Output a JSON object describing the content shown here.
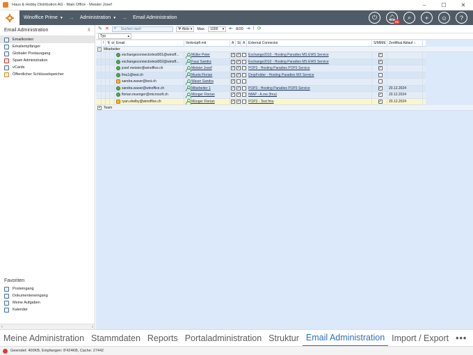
{
  "window": {
    "title": "Haus & Hobby Distribution AG - Main Office - Meister Josef"
  },
  "header": {
    "app_label": "Winoffice Prime",
    "section_label": "Administration",
    "page_label": "Email Administration",
    "notification_count": "65",
    "icons": [
      "power-icon",
      "bell-icon",
      "search-icon",
      "plus-icon",
      "user-icon",
      "help-icon"
    ]
  },
  "sidebar": {
    "title": "Email Administration",
    "items": [
      {
        "label": "Emailkonten"
      },
      {
        "label": "Emailempfänger"
      },
      {
        "label": "Globaler Postausgang"
      },
      {
        "label": "Spam Administration"
      },
      {
        "label": "vCards"
      },
      {
        "label": "Öffentlicher Schlüsselspeicher"
      }
    ],
    "favorites_title": "Favoriten",
    "favorites": [
      {
        "label": "Posteingang"
      },
      {
        "label": "Dokumenteneingang"
      },
      {
        "label": "Meine Aufgaben"
      },
      {
        "label": "Kalender"
      }
    ]
  },
  "toolbar": {
    "search_placeholder": "Suchen nach",
    "filter_value": "Aktiv",
    "max_label": "Max.",
    "max_value": "1000",
    "page_indicator": "8/20",
    "typ_label": "Typ"
  },
  "grid": {
    "columns": [
      "Email",
      "Verknüpft mit",
      "A",
      "St.",
      "A",
      "External Connector",
      "S/MIME",
      "Zertifikat Ablauf"
    ],
    "groups": [
      "Mitarbeiter",
      "Team"
    ],
    "rows": [
      {
        "email": "exchangeconnectortest001@winoff...",
        "status": "green",
        "linked": "Müller Peter",
        "c1": true,
        "c2": true,
        "c3": false,
        "connector": "Exchange2010 - Hosting Paradies MS EWS Service",
        "smime": true,
        "expiry": ""
      },
      {
        "email": "exchangeconnectortest002@winoff...",
        "status": "green",
        "linked": "Fauz Sandra",
        "c1": true,
        "c2": true,
        "c3": false,
        "connector": "Exchange2010 - Hosting Paradies MS EWS Service",
        "smime": true,
        "expiry": ""
      },
      {
        "email": "josef.meister@winoffice.ch",
        "status": "green",
        "linked": "Meister Josef",
        "c1": true,
        "c2": true,
        "c3": false,
        "connector": "POP3 - Hosting Paradies POP3 Service",
        "smime": true,
        "expiry": ""
      },
      {
        "email": "fmu1@test.ch",
        "status": "green",
        "linked": "Muela Florian",
        "c1": true,
        "c2": true,
        "c3": false,
        "connector": "DropFolder - Hosting Paradies MX Service",
        "smime": false,
        "expiry": ""
      },
      {
        "email": "sandra.waser@test.ch",
        "status": "lock",
        "linked": "Waser Sandra",
        "c1": true,
        "c2": false,
        "c3": false,
        "connector": "",
        "smime": false,
        "expiry": ""
      },
      {
        "email": "sandra.waser@winoffice.ch",
        "status": "green",
        "linked": "Mitarbeiter 1",
        "c1": true,
        "c2": true,
        "c3": false,
        "connector": "POP3 - Hosting Paradies POP3 Service",
        "smime": true,
        "expiry": "20.12.2024"
      },
      {
        "email": "florian.muenger@microsoft.ch",
        "status": "green",
        "linked": "Münger Florian",
        "c1": true,
        "c2": true,
        "c3": false,
        "connector": "IMAP - A.me (fmu)",
        "smime": true,
        "expiry": "20.12.2024"
      },
      {
        "email": "ryan.shelby@winoffice.ch",
        "status": "lock",
        "linked": "Münger Florian",
        "c1": true,
        "c2": true,
        "c3": false,
        "connector": "POP3 - Test fmu",
        "smime": true,
        "expiry": "20.12.2024"
      }
    ]
  },
  "tabs": [
    {
      "label": "Meine Administration"
    },
    {
      "label": "Stammdaten"
    },
    {
      "label": "Reports"
    },
    {
      "label": "Portaladministration"
    },
    {
      "label": "Struktur"
    },
    {
      "label": "Email Administration"
    },
    {
      "label": "Import / Export"
    },
    {
      "label": "•••"
    }
  ],
  "status_bar": {
    "text": "Geiendet: 400KB, Empfangen: 8'424KB, Cache: 27442"
  },
  "colors": {
    "header": "#4f5b66",
    "grid_bg": "#dce9fa",
    "active_tab": "#2f6fb5",
    "highlight_row": "#fbf6c9"
  }
}
